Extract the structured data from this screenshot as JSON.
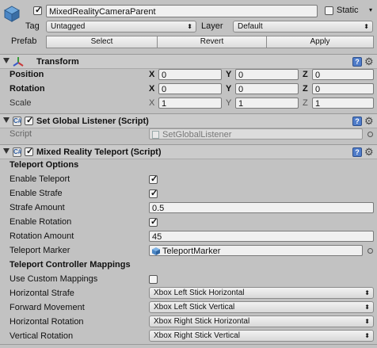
{
  "header": {
    "object_name": "MixedRealityCameraParent",
    "active": true,
    "static_label": "Static",
    "static_checked": false,
    "tag_label": "Tag",
    "tag_value": "Untagged",
    "layer_label": "Layer",
    "layer_value": "Default",
    "prefab_label": "Prefab",
    "select_label": "Select",
    "revert_label": "Revert",
    "apply_label": "Apply"
  },
  "transform": {
    "title": "Transform",
    "position_label": "Position",
    "rotation_label": "Rotation",
    "scale_label": "Scale",
    "x_label": "X",
    "y_label": "Y",
    "z_label": "Z",
    "position": {
      "x": "0",
      "y": "0",
      "z": "0"
    },
    "rotation": {
      "x": "0",
      "y": "0",
      "z": "0"
    },
    "scale": {
      "x": "1",
      "y": "1",
      "z": "1"
    }
  },
  "global_listener": {
    "title": "Set Global Listener (Script)",
    "enabled": true,
    "script_label": "Script",
    "script_value": "SetGlobalListener"
  },
  "teleport": {
    "title": "Mixed Reality Teleport (Script)",
    "enabled": true,
    "options_heading": "Teleport Options",
    "enable_teleport_label": "Enable Teleport",
    "enable_teleport": true,
    "enable_strafe_label": "Enable Strafe",
    "enable_strafe": true,
    "strafe_amount_label": "Strafe Amount",
    "strafe_amount": "0.5",
    "enable_rotation_label": "Enable Rotation",
    "enable_rotation": true,
    "rotation_amount_label": "Rotation Amount",
    "rotation_amount": "45",
    "teleport_marker_label": "Teleport Marker",
    "teleport_marker": "TeleportMarker",
    "mappings_heading": "Teleport Controller Mappings",
    "use_custom_mappings_label": "Use Custom Mappings",
    "use_custom_mappings": false,
    "horizontal_strafe_label": "Horizontal Strafe",
    "horizontal_strafe": "Xbox Left Stick Horizontal",
    "forward_movement_label": "Forward Movement",
    "forward_movement": "Xbox Left Stick Vertical",
    "horizontal_rotation_label": "Horizontal Rotation",
    "horizontal_rotation": "Xbox Right Stick Horizontal",
    "vertical_rotation_label": "Vertical Rotation",
    "vertical_rotation": "Xbox Right Stick Vertical"
  },
  "icons": {
    "help": "?",
    "gear": "⚙",
    "check": "✓",
    "dropdown_arrow": "⬍"
  },
  "colors": {
    "background": "#c2c2c2",
    "section_header": "#cbcbcb",
    "help_icon": "#4f7cc9"
  }
}
